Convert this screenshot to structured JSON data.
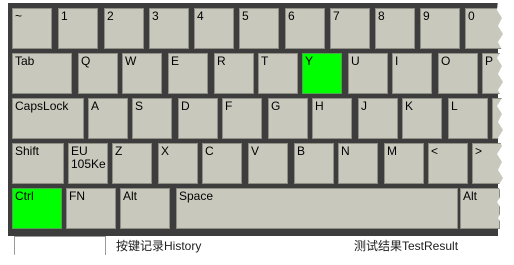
{
  "colors": {
    "panel_background": "#3d3d3d",
    "key_background": "#c8c8bd",
    "key_highlight": "#00ff00"
  },
  "keyboard": {
    "rows": [
      {
        "keys": [
          {
            "label": "~"
          },
          {
            "label": "1"
          },
          {
            "label": "2"
          },
          {
            "label": "3"
          },
          {
            "label": "4"
          },
          {
            "label": "5"
          },
          {
            "label": "6"
          },
          {
            "label": "7"
          },
          {
            "label": "8"
          },
          {
            "label": "9"
          },
          {
            "label": "0"
          }
        ]
      },
      {
        "keys": [
          {
            "label": "Tab"
          },
          {
            "label": "Q"
          },
          {
            "label": "W"
          },
          {
            "label": "E"
          },
          {
            "label": "R"
          },
          {
            "label": "T"
          },
          {
            "label": "Y",
            "highlighted": true
          },
          {
            "label": "U"
          },
          {
            "label": "I"
          },
          {
            "label": "O"
          },
          {
            "label": "P"
          }
        ]
      },
      {
        "keys": [
          {
            "label": "CapsLock"
          },
          {
            "label": "A"
          },
          {
            "label": "S"
          },
          {
            "label": "D"
          },
          {
            "label": "F"
          },
          {
            "label": "G"
          },
          {
            "label": "H"
          },
          {
            "label": "J"
          },
          {
            "label": "K"
          },
          {
            "label": "L"
          },
          {
            "label": ""
          }
        ]
      },
      {
        "keys": [
          {
            "label": "Shift"
          },
          {
            "label": "EU\n105Ke"
          },
          {
            "label": "Z"
          },
          {
            "label": "X"
          },
          {
            "label": "C"
          },
          {
            "label": "V"
          },
          {
            "label": "B"
          },
          {
            "label": "N"
          },
          {
            "label": "M"
          },
          {
            "label": "<"
          },
          {
            "label": ">"
          }
        ]
      },
      {
        "keys": [
          {
            "label": "Ctrl",
            "highlighted": true
          },
          {
            "label": "FN"
          },
          {
            "label": "Alt"
          },
          {
            "label": "Space"
          },
          {
            "label": "Alt"
          }
        ]
      }
    ]
  },
  "tabs": [
    {
      "label": ""
    },
    {
      "label": "按键记录History"
    },
    {
      "label": "测试结果TestResult"
    }
  ]
}
